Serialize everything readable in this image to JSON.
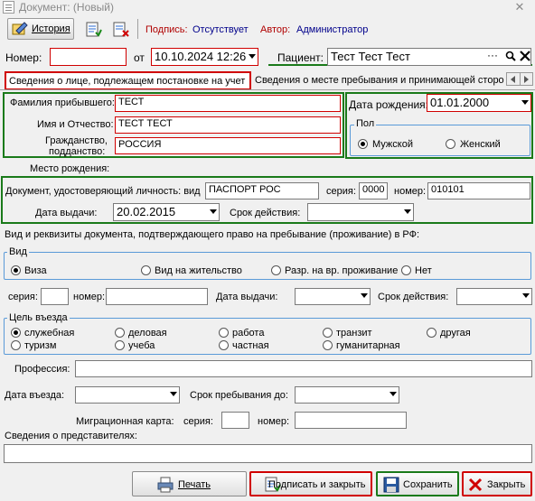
{
  "window": {
    "title": "Документ: (Новый)",
    "close": "✕"
  },
  "toolbar": {
    "history_label": "История",
    "signature_label": "Подпись:",
    "signature_value": "Отсутствует",
    "author_label": "Автор:",
    "author_value": "Администратор"
  },
  "header": {
    "number_label": "Номер:",
    "number_value": "",
    "from_label": "от",
    "date_value": "10.10.2024 12:26",
    "patient_label": "Пациент:",
    "patient_value": "Тест Тест Тест",
    "patient_more": "···"
  },
  "tabs": [
    {
      "label": "Сведения о лице, подлежащем постановке на учет"
    },
    {
      "label": "Сведения о месте пребывания и принимающей сторо"
    }
  ],
  "person": {
    "surname_label": "Фамилия прибывшего:",
    "surname_value": "ТЕСТ",
    "name_label": "Имя и Отчество:",
    "name_value": "ТЕСТ ТЕСТ",
    "citizenship_label_1": "Гражданство,",
    "citizenship_label_2": "подданство:",
    "citizenship_value": "РОССИЯ",
    "birthplace_label": "Место рождения:",
    "birthplace_value": "",
    "birthdate_label": "Дата рождения:",
    "birthdate_value": "01.01.2000",
    "gender_title": "Пол",
    "gender_male": "Мужской",
    "gender_female": "Женский",
    "gender_selected": "male"
  },
  "id_doc": {
    "label": "Документ, удостоверяющий личность: вид",
    "type_value": "ПАСПОРТ РОС",
    "series_label": "серия:",
    "series_value": "0000",
    "number_label": "номер:",
    "number_value": "010101",
    "issue_label": "Дата выдачи:",
    "issue_value": "20.02.2015",
    "validity_label": "Срок действия:",
    "validity_value": ""
  },
  "residence_doc": {
    "heading": "Вид и реквизиты документа, подтверждающего право на пребывание (проживание) в РФ:",
    "kind_title": "Вид",
    "kinds": [
      "Виза",
      "Вид на жительство",
      "Разр. на вр. проживание",
      "Нет"
    ],
    "kind_selected": 0,
    "series_label": "серия:",
    "number_label": "номер:",
    "issue_label": "Дата выдачи:",
    "validity_label": "Срок действия:"
  },
  "purpose": {
    "title": "Цель въезда",
    "options": [
      "служебная",
      "деловая",
      "работа",
      "транзит",
      "другая",
      "туризм",
      "учеба",
      "частная",
      "гуманитарная"
    ],
    "selected": 0
  },
  "extra": {
    "profession_label": "Профессия:",
    "entry_date_label": "Дата въезда:",
    "stay_until_label": "Срок пребывания до:",
    "migration_card_label": "Миграционная карта:",
    "mc_series_label": "серия:",
    "mc_number_label": "номер:",
    "representatives_label": "Сведения о представителях:"
  },
  "buttons": {
    "print": "Печать",
    "sign_close": "Подписать и закрыть",
    "save": "Сохранить",
    "close": "Закрыть"
  }
}
